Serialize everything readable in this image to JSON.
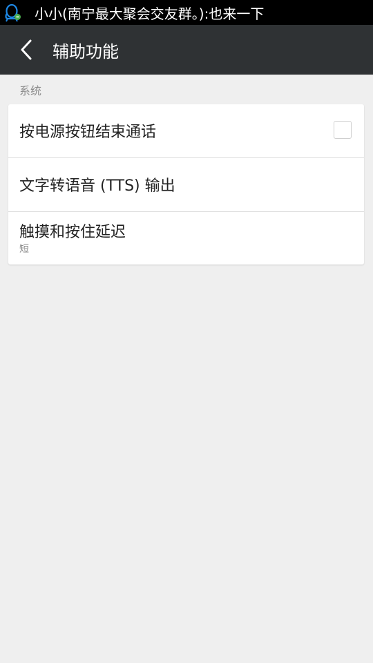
{
  "status_bar": {
    "notification_icon": "qq-penguin-icon",
    "ticker_text": "小小(南宁最大聚会交友群。):也来一下"
  },
  "app_bar": {
    "back_icon": "chevron-left-icon",
    "title": "辅助功能"
  },
  "section": {
    "label": "系统"
  },
  "settings": {
    "items": [
      {
        "label": "按电源按钮结束通话",
        "checked": false
      },
      {
        "label": "文字转语音 (TTS) 输出"
      },
      {
        "label": "触摸和按住延迟",
        "summary": "短"
      }
    ]
  },
  "colors": {
    "status_bar_bg": "#000000",
    "app_bar_bg": "#2f3234",
    "page_bg": "#efefef",
    "card_bg": "#ffffff",
    "icon_accent": "#1e88e5"
  }
}
